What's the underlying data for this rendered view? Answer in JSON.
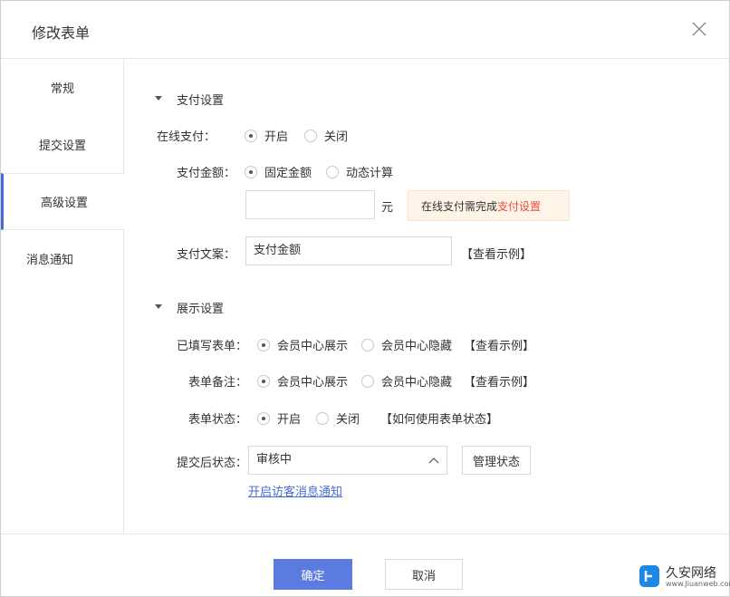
{
  "dialog": {
    "title": "修改表单",
    "close_icon": "close-icon"
  },
  "sidebar": {
    "items": [
      {
        "label": "常规"
      },
      {
        "label": "提交设置"
      },
      {
        "label": "高级设置",
        "active": true
      },
      {
        "label": "消息通知"
      }
    ]
  },
  "payment": {
    "section_title": "支付设置",
    "online_label": "在线支付：",
    "online_on": "开启",
    "online_off": "关闭",
    "amount_label": "支付金额：",
    "amount_fixed": "固定金额",
    "amount_dynamic": "动态计算",
    "amount_value": "",
    "amount_unit": "元",
    "tip_prefix": "在线支付需完成",
    "tip_link": "支付设置",
    "copy_label": "支付文案：",
    "copy_value": "支付金额",
    "example": "【查看示例】"
  },
  "display": {
    "section_title": "展示设置",
    "filled_label": "已填写表单：",
    "filled_show": "会员中心展示",
    "filled_hide": "会员中心隐藏",
    "filled_example": "【查看示例】",
    "remark_label": "表单备注：",
    "remark_show": "会员中心展示",
    "remark_hide": "会员中心隐藏",
    "remark_example": "【查看示例】",
    "status_label": "表单状态：",
    "status_on": "开启",
    "status_off": "关闭",
    "status_help": "【如何使用表单状态】",
    "after_label": "提交后状态：",
    "after_value": "审核中",
    "manage_button": "管理状态",
    "notify_link": "开启访客消息通知"
  },
  "footer": {
    "confirm": "确定",
    "cancel": "取消"
  },
  "watermark": {
    "name": "久安网络",
    "site": "www.Jiuanweb.com"
  },
  "colors": {
    "primary": "#5b7be0",
    "link": "#4a6bd6",
    "tip_bg": "#fff4e8",
    "highlight": "#e74c3c"
  }
}
